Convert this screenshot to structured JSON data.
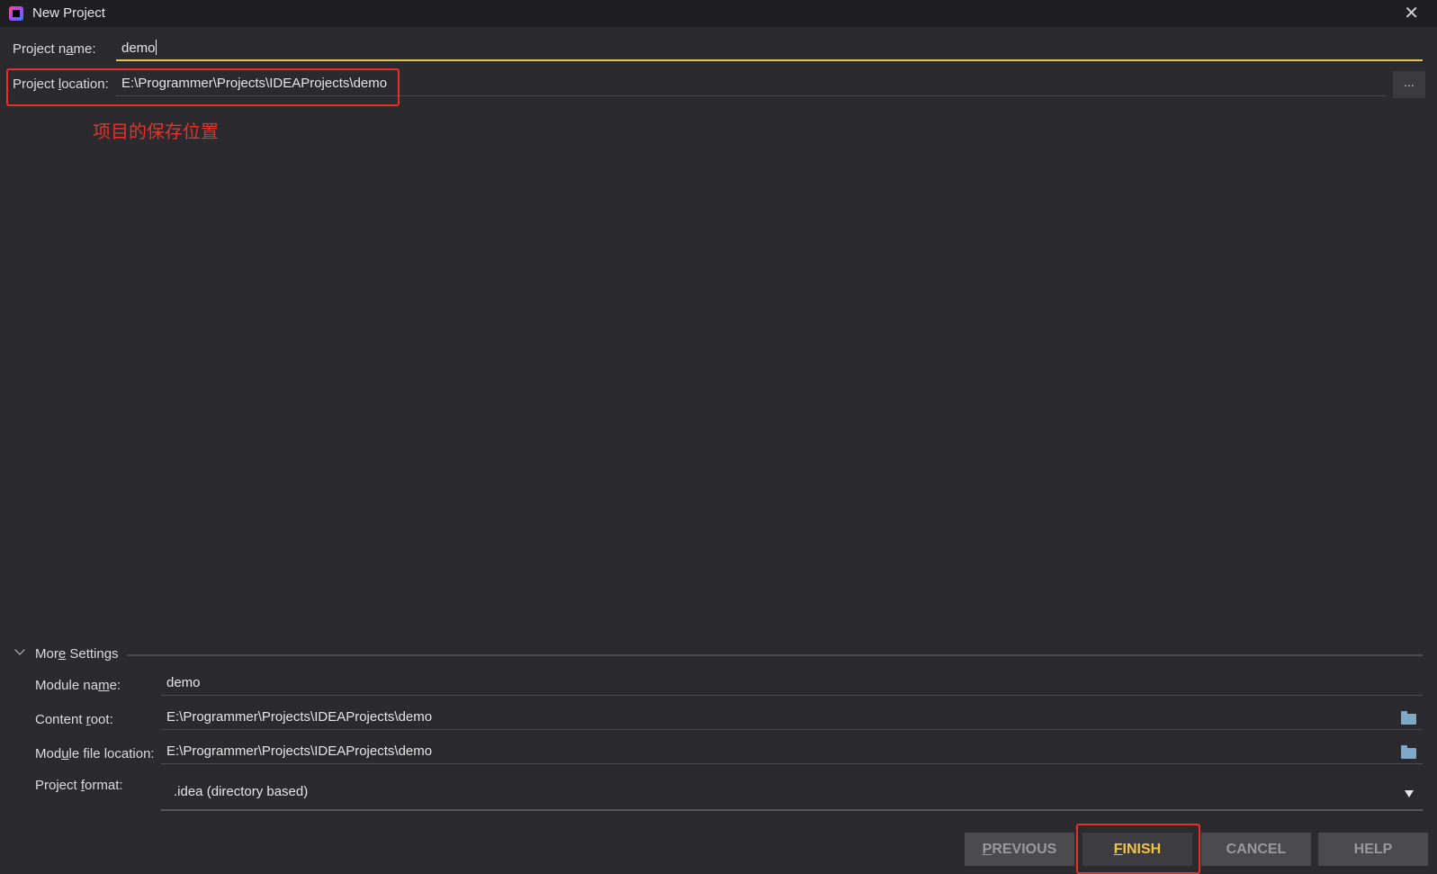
{
  "window": {
    "title": "New Project",
    "app_icon": "intellij-idea-icon",
    "close_label": "✕"
  },
  "project": {
    "name_label": "Project name:",
    "name_value": "demo",
    "location_label": "Project location:",
    "location_value": "E:\\Programmer\\Projects\\IDEAProjects\\demo",
    "browse_label": "..."
  },
  "annotation": {
    "text": "项目的保存位置",
    "color": "#e4322b"
  },
  "more_settings": {
    "title": "More Settings",
    "module_name_label": "Module name:",
    "module_name_value": "demo",
    "content_root_label": "Content root:",
    "content_root_value": "E:\\Programmer\\Projects\\IDEAProjects\\demo",
    "module_file_label": "Module file location:",
    "module_file_value": "E:\\Programmer\\Projects\\IDEAProjects\\demo",
    "format_label": "Project format:",
    "format_value": ".idea (directory based)"
  },
  "buttons": {
    "previous": "PREVIOUS",
    "finish": "FINISH",
    "cancel": "CANCEL",
    "help": "HELP"
  },
  "colors": {
    "accent": "#e8c34a",
    "finish_text": "#f0c540",
    "background": "#2b2b2f"
  }
}
